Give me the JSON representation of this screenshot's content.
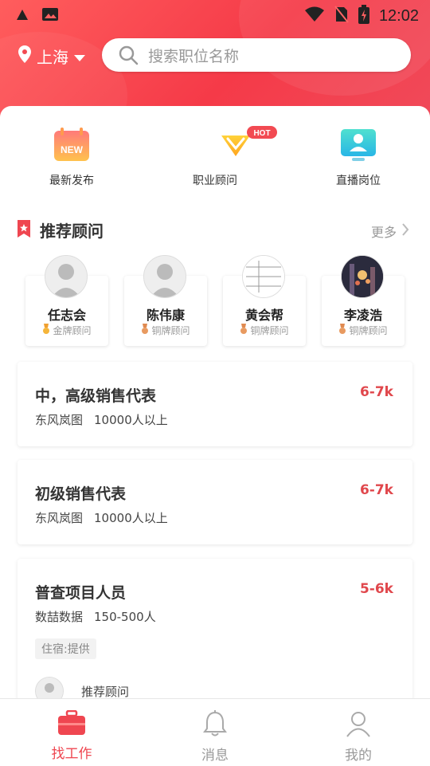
{
  "status_bar": {
    "time": "12:02"
  },
  "header": {
    "city": "上海",
    "search_placeholder": "搜索职位名称"
  },
  "quick_menu": [
    {
      "label": "最新发布",
      "icon": "calendar-new-icon",
      "badge": "NEW"
    },
    {
      "label": "职业顾问",
      "icon": "advisor-diamond-icon",
      "badge": "HOT"
    },
    {
      "label": "直播岗位",
      "icon": "live-screen-icon"
    }
  ],
  "recommend": {
    "title": "推荐顾问",
    "more": "更多",
    "advisors": [
      {
        "name": "任志会",
        "level": "金牌顾问"
      },
      {
        "name": "陈伟康",
        "level": "铜牌顾问"
      },
      {
        "name": "黄会帮",
        "level": "铜牌顾问"
      },
      {
        "name": "李凌浩",
        "level": "铜牌顾问"
      }
    ]
  },
  "jobs": [
    {
      "title": "中，高级销售代表",
      "salary": "6-7k",
      "company": "东风岚图",
      "size": "10000人以上"
    },
    {
      "title": "初级销售代表",
      "salary": "6-7k",
      "company": "东风岚图",
      "size": "10000人以上"
    },
    {
      "title": "普查项目人员",
      "salary": "5-6k",
      "company": "数喆数据",
      "size": "150-500人",
      "tag": "住宿:提供",
      "advisor_label": "推荐顾问"
    }
  ],
  "tabbar": [
    {
      "label": "找工作",
      "icon": "briefcase-icon",
      "active": true
    },
    {
      "label": "消息",
      "icon": "bell-icon"
    },
    {
      "label": "我的",
      "icon": "user-icon"
    }
  ],
  "colors": {
    "accent": "#ef4650",
    "header_start": "#ff5d5d",
    "header_end": "#f04a5a"
  }
}
